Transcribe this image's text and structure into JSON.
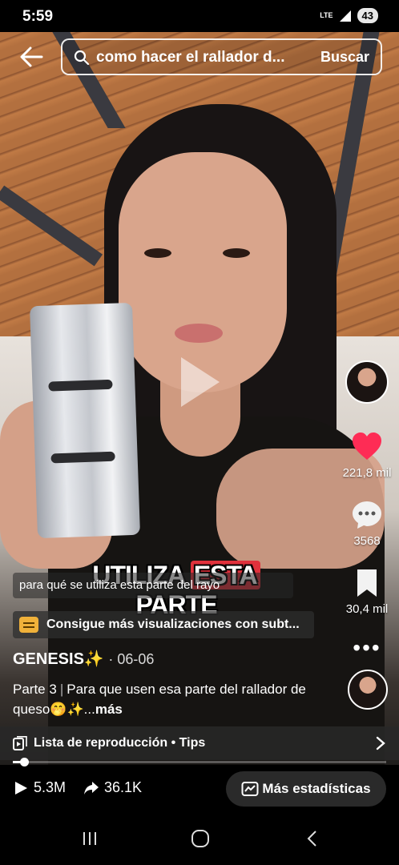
{
  "status_bar": {
    "time": "5:59",
    "network": "LTE",
    "battery": "43"
  },
  "search": {
    "query": "como hacer el rallador d...",
    "button_label": "Buscar"
  },
  "video": {
    "overlay_caption_part1": "UTILIZA ",
    "overlay_caption_highlight": "ESTA",
    "overlay_caption_part2": " PARTE",
    "subtitle": "para qué se utiliza esta parte del rayo"
  },
  "rail": {
    "likes": "221,8 mil",
    "comments": "3568",
    "saves": "30,4 mil"
  },
  "subtitles_banner": "Consigue más visualizaciones con subt...",
  "author": {
    "name": "GENESIS✨",
    "date": "· 06-06"
  },
  "description": {
    "part": "Parte 3",
    "text": "Para que usen esa parte del rallador de queso🤭✨...",
    "more": "más"
  },
  "playlist": {
    "label": "Lista de reproducción • Tips"
  },
  "progress": {
    "fraction": 0.03
  },
  "stats": {
    "plays": "5.3M",
    "shares": "36.1K",
    "more_stats": "Más estadísticas"
  },
  "colors": {
    "like": "#fe2c55",
    "highlight": "#e0313c",
    "cc": "#f0b13a"
  }
}
